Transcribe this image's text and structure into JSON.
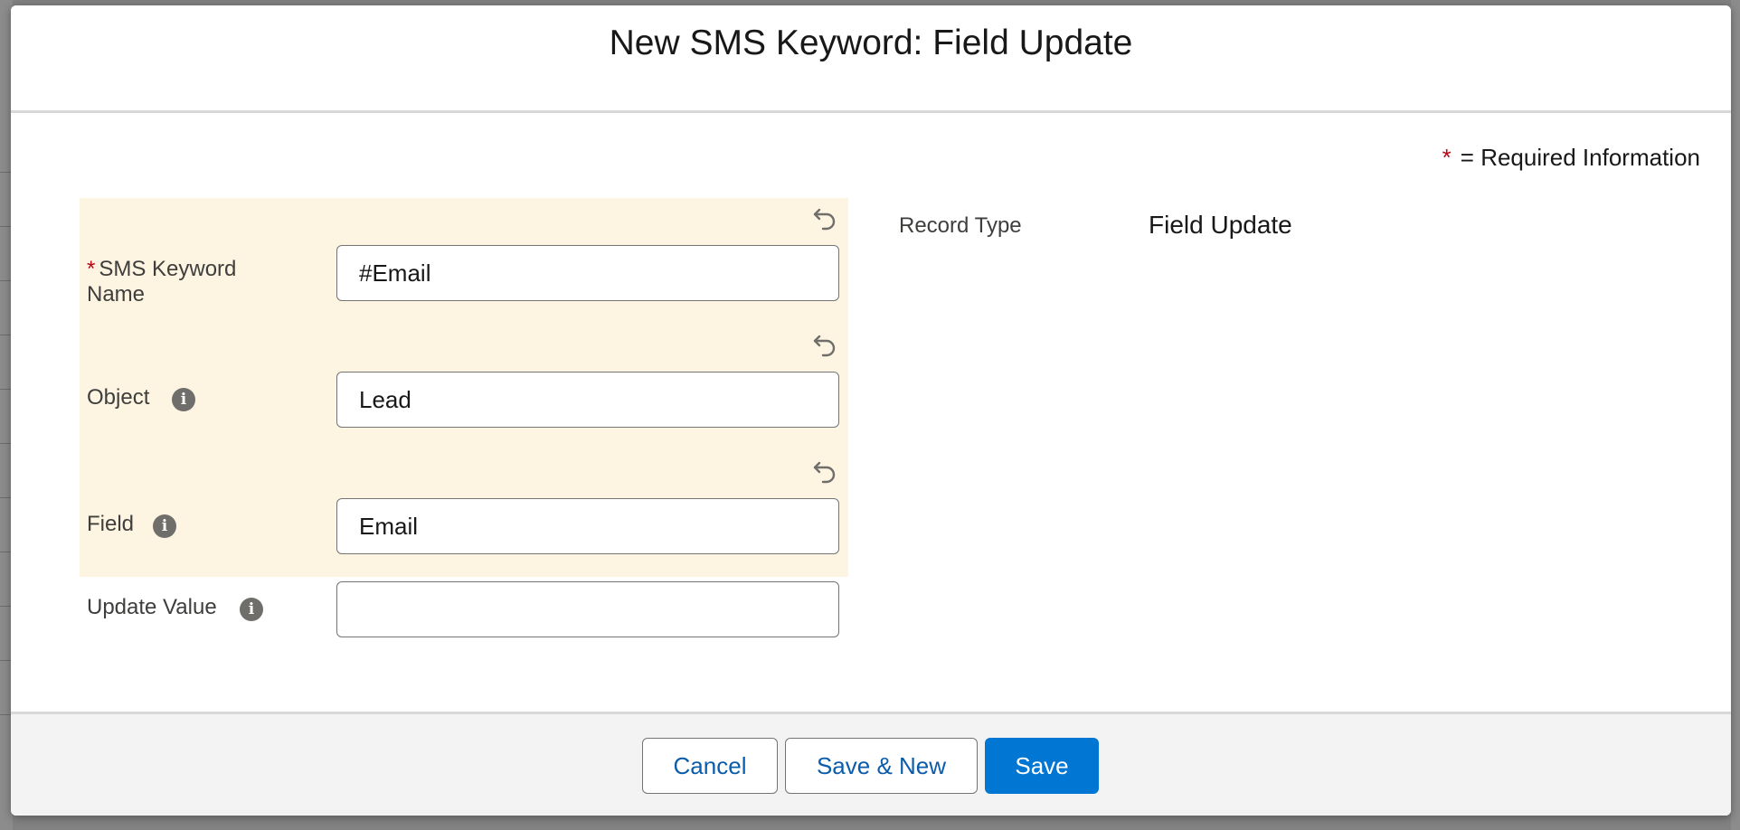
{
  "modal": {
    "title": "New SMS Keyword: Field Update",
    "required_note": "= Required Information",
    "required_marker": "*"
  },
  "form": {
    "sms_keyword_name": {
      "label": "SMS Keyword Name",
      "required_marker": "*",
      "value": "#Email"
    },
    "object": {
      "label": "Object",
      "value": "Lead"
    },
    "field": {
      "label": "Field",
      "value": "Email"
    },
    "update_value": {
      "label": "Update Value",
      "value": ""
    }
  },
  "details": {
    "record_type_label": "Record Type",
    "record_type_value": "Field Update"
  },
  "footer": {
    "cancel_label": "Cancel",
    "save_new_label": "Save & New",
    "save_label": "Save"
  },
  "icons": {
    "undo": "undo-icon",
    "info": "info-icon",
    "info_glyph": "i"
  },
  "colors": {
    "brand": "#0176d3",
    "required": "#ba0517",
    "highlight": "#fdf4e2",
    "link": "#0b5cab"
  }
}
